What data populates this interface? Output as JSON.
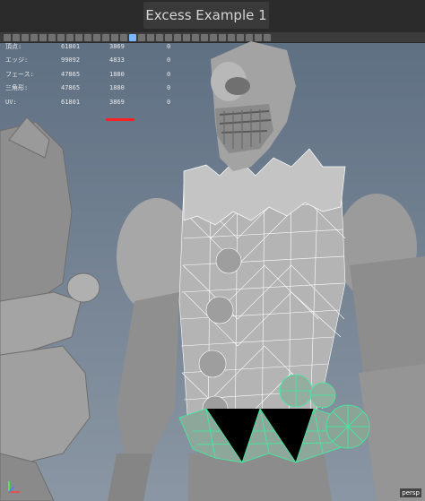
{
  "window": {
    "title": "Excess Example 1"
  },
  "hud": {
    "rows": [
      {
        "label": "頂点:",
        "total": "61801",
        "selected": "3869",
        "extra": "0"
      },
      {
        "label": "エッジ:",
        "total": "99092",
        "selected": "4833",
        "extra": "0"
      },
      {
        "label": "フェース:",
        "total": "47865",
        "selected": "1880",
        "extra": "0"
      },
      {
        "label": "三角形:",
        "total": "47865",
        "selected": "1880",
        "extra": "0"
      },
      {
        "label": "UV:",
        "total": "61801",
        "selected": "3869",
        "extra": "0"
      }
    ]
  },
  "colors": {
    "viewport_top": "#5e6f82",
    "viewport_bottom": "#8a96a3",
    "wireframe_white": "#ffffff",
    "wireframe_green": "#3cf0a0",
    "highlight_underline": "#ff2020",
    "model_gray": "#9a9a9a"
  },
  "viewport": {
    "corner_label": "persp"
  }
}
